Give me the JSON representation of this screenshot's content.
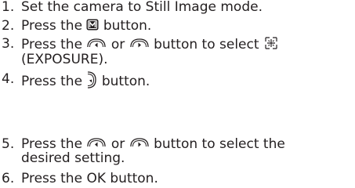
{
  "steps": [
    {
      "number": "1.",
      "text": "Set the camera to Still Image mode."
    },
    {
      "number": "2.",
      "before": "Press the",
      "icon": "menu-m-button-icon",
      "after": "button."
    },
    {
      "number": "3.",
      "before": "Press the",
      "icon1": "left-arrow-button-icon",
      "middle": "or",
      "icon2": "right-arrow-button-icon",
      "after": "button to select",
      "icon3": "exposure-icon",
      "line2": "(EXPOSURE)."
    },
    {
      "number": "4.",
      "before": "Press the",
      "icon": "down-arrow-button-icon",
      "after": "button."
    },
    {
      "number": "5.",
      "before": "Press the",
      "icon1": "left-arrow-button-icon",
      "middle": "or",
      "icon2": "right-arrow-button-icon",
      "after": "button to select the",
      "line2": "desired setting."
    },
    {
      "number": "6.",
      "text": "Press the OK button."
    }
  ],
  "colors": {
    "text": "#231f20"
  }
}
